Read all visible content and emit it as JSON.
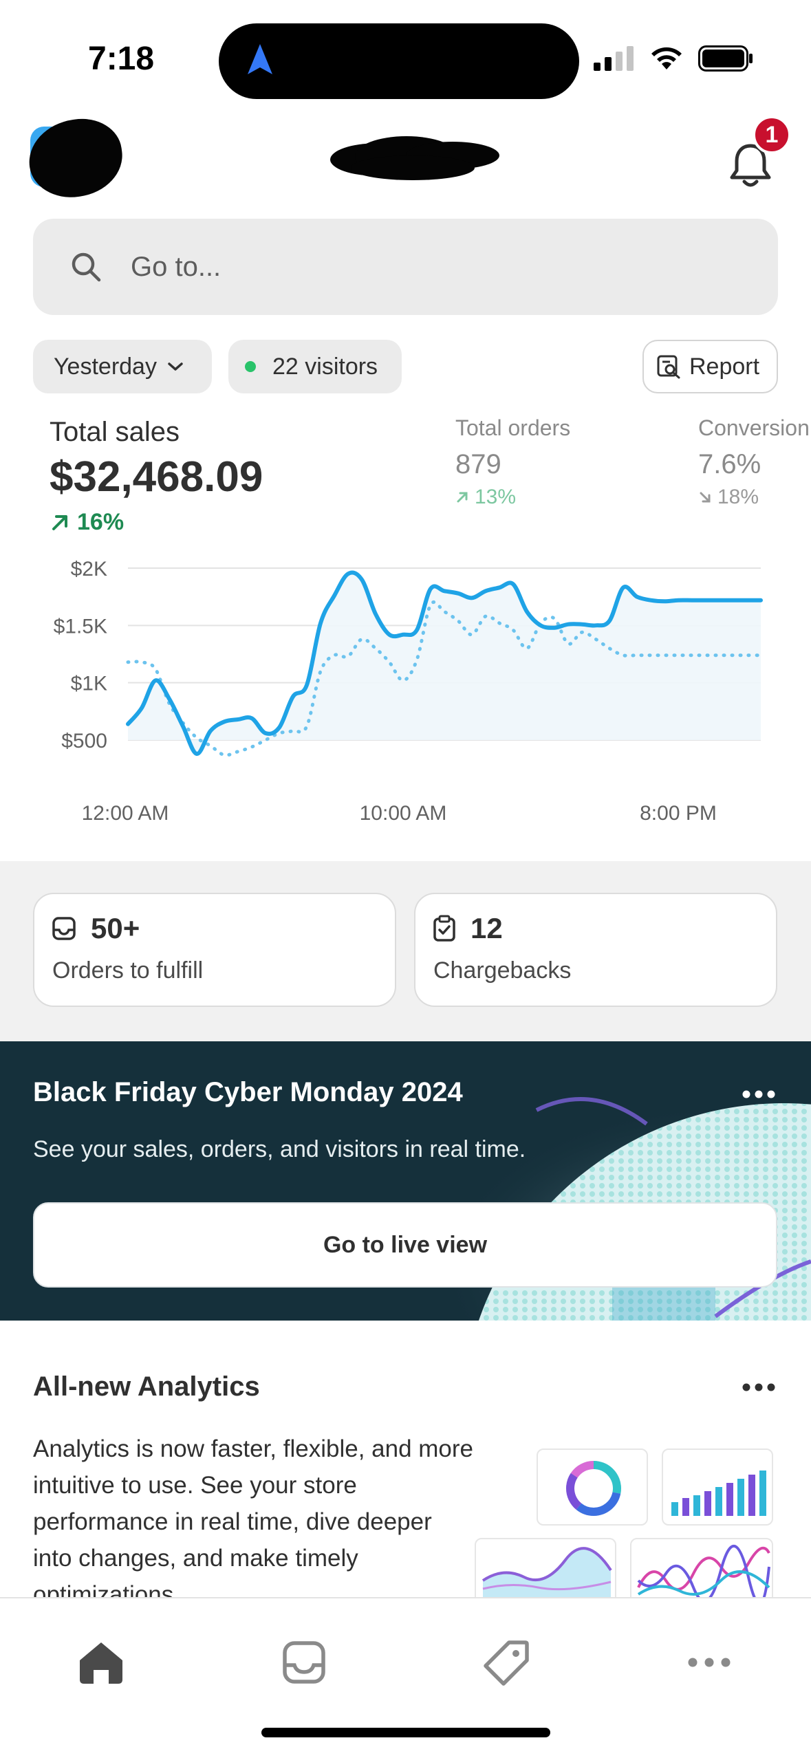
{
  "status_bar": {
    "time": "7:18"
  },
  "header": {
    "notification_count": "1"
  },
  "search": {
    "placeholder": "Go to..."
  },
  "filters": {
    "date_label": "Yesterday",
    "visitors_label": "22 visitors",
    "report_label": "Report"
  },
  "metrics": {
    "total_sales": {
      "label": "Total sales",
      "value": "$32,468.09",
      "change": "16%"
    },
    "total_orders": {
      "label": "Total orders",
      "value": "879",
      "change": "13%"
    },
    "conversion": {
      "label": "Conversion",
      "value": "7.6%",
      "change": "18%"
    }
  },
  "chart_data": {
    "type": "line",
    "ylim": [
      0,
      2000
    ],
    "y_ticks": [
      "$2K",
      "$1.5K",
      "$1K",
      "$500"
    ],
    "y_tick_values": [
      2000,
      1500,
      1000,
      500
    ],
    "x_ticks": [
      "12:00 AM",
      "10:00 AM",
      "8:00 PM"
    ],
    "x_tick_hours": [
      0,
      10,
      20
    ],
    "x_range": [
      0,
      23
    ],
    "series": [
      {
        "style": "solid",
        "color": "#1fa3e6",
        "x": [
          0,
          0.5,
          1,
          1.5,
          2,
          2.5,
          3,
          3.5,
          4,
          4.5,
          5,
          5.5,
          6,
          6.5,
          7,
          7.5,
          8,
          8.5,
          9,
          9.5,
          10,
          10.5,
          11,
          11.5,
          12,
          12.5,
          13,
          13.5,
          14,
          14.5,
          15,
          15.5,
          16,
          16.5,
          17,
          17.5,
          18,
          18.5,
          19,
          19.5,
          20,
          20.5,
          21,
          21.5,
          22,
          22.5,
          23
        ],
        "values": [
          640,
          780,
          1020,
          860,
          620,
          380,
          580,
          660,
          680,
          690,
          560,
          610,
          880,
          980,
          1520,
          1760,
          1950,
          1900,
          1600,
          1420,
          1420,
          1460,
          1820,
          1800,
          1780,
          1740,
          1800,
          1830,
          1860,
          1620,
          1500,
          1480,
          1510,
          1510,
          1500,
          1540,
          1830,
          1750,
          1720,
          1710,
          1720,
          1720,
          1720,
          1720,
          1720,
          1720,
          1720
        ]
      },
      {
        "style": "dotted",
        "color": "#6cc3ee",
        "x": [
          0,
          0.5,
          1,
          1.5,
          2,
          2.5,
          3,
          3.5,
          4,
          4.5,
          5,
          5.5,
          6,
          6.5,
          7,
          7.5,
          8,
          8.5,
          9,
          9.5,
          10,
          10.5,
          11,
          11.5,
          12,
          12.5,
          13,
          13.5,
          14,
          14.5,
          15,
          15.5,
          16,
          16.5,
          17,
          17.5,
          18,
          18.5,
          19,
          19.5,
          20,
          20.5,
          21,
          21.5,
          22,
          22.5,
          23
        ],
        "values": [
          1180,
          1180,
          1120,
          820,
          650,
          520,
          450,
          370,
          400,
          440,
          500,
          560,
          580,
          620,
          1100,
          1240,
          1230,
          1380,
          1300,
          1180,
          1020,
          1200,
          1680,
          1620,
          1540,
          1420,
          1580,
          1520,
          1460,
          1300,
          1520,
          1560,
          1340,
          1440,
          1380,
          1300,
          1240,
          1240,
          1240,
          1240,
          1240,
          1240,
          1240,
          1240,
          1240,
          1240,
          1240
        ]
      }
    ]
  },
  "cards": {
    "orders": {
      "value": "50+",
      "label": "Orders to fulfill"
    },
    "chargebacks": {
      "value": "12",
      "label": "Chargebacks"
    }
  },
  "bfcm": {
    "title": "Black Friday Cyber Monday 2024",
    "subtitle": "See your sales, orders, and visitors in real time.",
    "button_label": "Go to live view"
  },
  "analytics": {
    "title": "All-new Analytics",
    "body": "Analytics is now faster, flexible, and more intuitive to use. See your store performance in real time, dive deeper into changes, and make timely optimizations."
  },
  "colors": {
    "accent_line": "#1fa3e6",
    "positive": "#1e8a52",
    "badge": "#c8102e",
    "banner_bg": "#15303b"
  },
  "icons": {
    "tabs": [
      "home-icon",
      "inbox-icon",
      "tag-icon",
      "more-icon"
    ]
  }
}
